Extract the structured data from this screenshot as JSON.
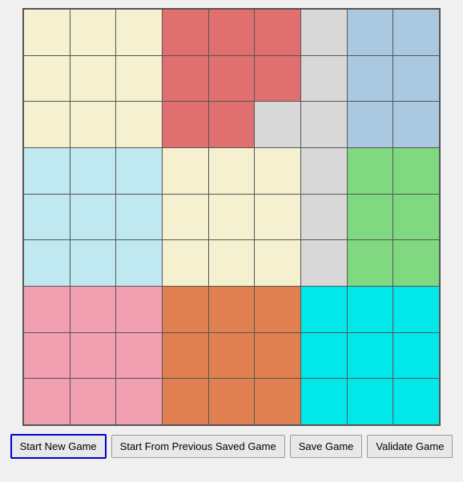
{
  "grid": {
    "rows": 9,
    "cols": 9,
    "cells": [
      [
        "cream",
        "cream",
        "cream",
        "salmon",
        "salmon",
        "salmon",
        "none",
        "lightblue",
        "lightblue"
      ],
      [
        "cream",
        "cream",
        "cream",
        "salmon",
        "salmon",
        "salmon",
        "none",
        "lightblue",
        "lightblue"
      ],
      [
        "cream",
        "cream",
        "cream",
        "salmon",
        "salmon",
        "none",
        "none",
        "lightblue",
        "lightblue"
      ],
      [
        "lightcyan",
        "lightcyan",
        "lightcyan",
        "cream",
        "cream",
        "cream",
        "none",
        "green",
        "green"
      ],
      [
        "lightcyan",
        "lightcyan",
        "lightcyan",
        "cream",
        "cream",
        "cream",
        "none",
        "green",
        "green"
      ],
      [
        "lightcyan",
        "lightcyan",
        "lightcyan",
        "cream",
        "cream",
        "cream",
        "none",
        "green",
        "green"
      ],
      [
        "pink",
        "pink",
        "pink",
        "orange",
        "orange",
        "orange",
        "cyan",
        "cyan",
        "cyan"
      ],
      [
        "pink",
        "pink",
        "pink",
        "orange",
        "orange",
        "orange",
        "cyan",
        "cyan",
        "cyan"
      ],
      [
        "pink",
        "pink",
        "pink",
        "orange",
        "orange",
        "orange",
        "cyan",
        "cyan",
        "cyan"
      ]
    ],
    "colorMap": {
      "cream": "#f5f0d0",
      "salmon": "#e07070",
      "lightblue": "#aac8e0",
      "lightcyan": "#c0e8f0",
      "green": "#80d880",
      "pink": "#f0a0b0",
      "orange": "#e08050",
      "cyan": "#00e8e8",
      "none": "#d8d8d8"
    }
  },
  "buttons": {
    "start_new_game": "Start New Game",
    "start_from_saved": "Start From Previous Saved Game",
    "save_game": "Save Game",
    "validate_game": "Validate Game"
  }
}
